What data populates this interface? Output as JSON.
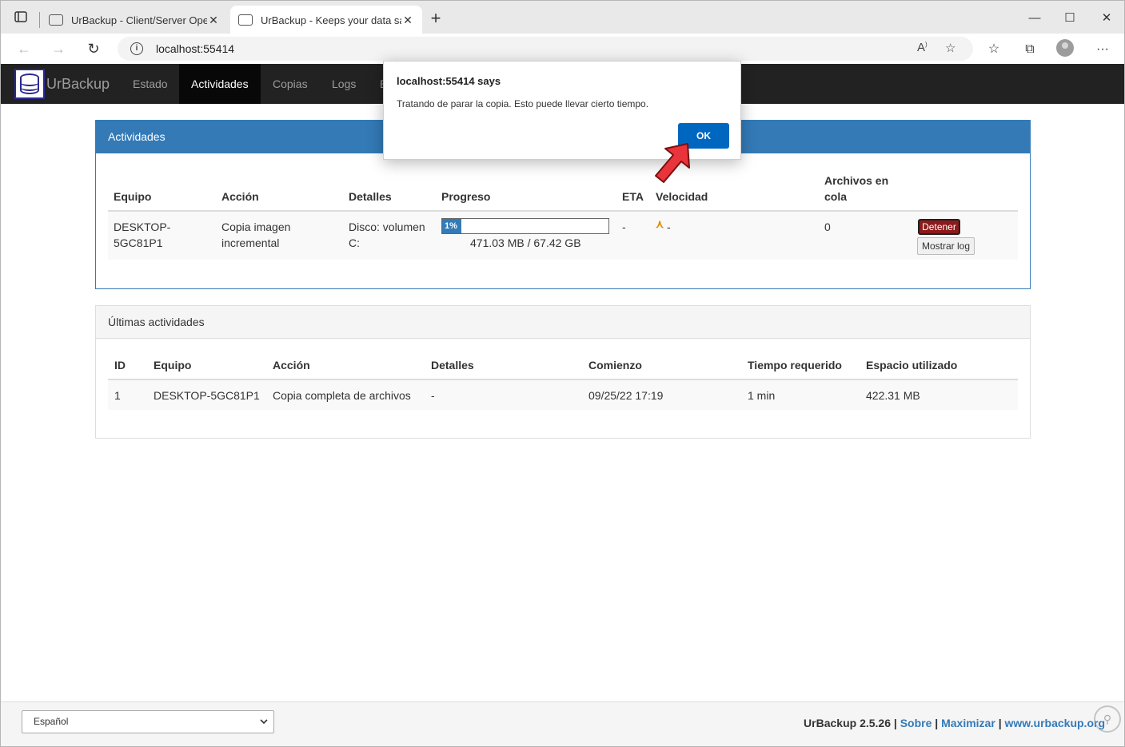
{
  "browser": {
    "tabs": [
      {
        "title": "UrBackup - Client/Server Open Source"
      },
      {
        "title": "UrBackup - Keeps your data safe"
      }
    ],
    "url": "localhost:55414",
    "new_tab": "+",
    "window": {
      "minimize": "—",
      "maximize": "☐",
      "close": "✕"
    }
  },
  "app": {
    "brand": "UrBackup",
    "nav": [
      {
        "label": "Estado"
      },
      {
        "label": "Actividades"
      },
      {
        "label": "Copias"
      },
      {
        "label": "Logs"
      },
      {
        "label": "E"
      }
    ]
  },
  "activities": {
    "title": "Actividades",
    "headers": {
      "equipo": "Equipo",
      "accion": "Acción",
      "detalles": "Detalles",
      "progreso": "Progreso",
      "eta": "ETA",
      "velocidad": "Velocidad",
      "archivos_line1": "Archivos en",
      "archivos_line2": "cola"
    },
    "row": {
      "equipo_line1": "DESKTOP-",
      "equipo_line2": "5GC81P1",
      "accion_line1": "Copia imagen",
      "accion_line2": "incremental",
      "detalles_line1": "Disco: volumen",
      "detalles_line2": "C:",
      "progress_label": "1%",
      "progress_fraction": 0.01,
      "progress_size": "471.03 MB / 67.42 GB",
      "eta": "-",
      "speed": "-",
      "queue": "0",
      "stop_button": "Detener",
      "log_button": "Mostrar log"
    }
  },
  "last_activities": {
    "title": "Últimas actividades",
    "headers": {
      "id": "ID",
      "equipo": "Equipo",
      "accion": "Acción",
      "detalles": "Detalles",
      "comienzo": "Comienzo",
      "tiempo": "Tiempo requerido",
      "espacio": "Espacio utilizado"
    },
    "rows": [
      {
        "id": "1",
        "equipo": "DESKTOP-5GC81P1",
        "accion": "Copia completa de archivos",
        "detalles": "-",
        "comienzo": "09/25/22 17:19",
        "tiempo": "1 min",
        "espacio": "422.31 MB"
      }
    ]
  },
  "footer": {
    "language": "Español",
    "version": "UrBackup 2.5.26",
    "sep": "|",
    "about": "Sobre",
    "maximize": "Maximizar",
    "site": "www.urbackup.org"
  },
  "dialog": {
    "title": "localhost:55414 says",
    "message": "Tratando de parar la copia. Esto puede llevar cierto tiempo.",
    "ok": "OK"
  },
  "colors": {
    "primary": "#337ab7",
    "navbar": "#222222",
    "stop": "#8b1a1a",
    "dialog_ok": "#0067c0",
    "pointer": "#e8343a"
  }
}
